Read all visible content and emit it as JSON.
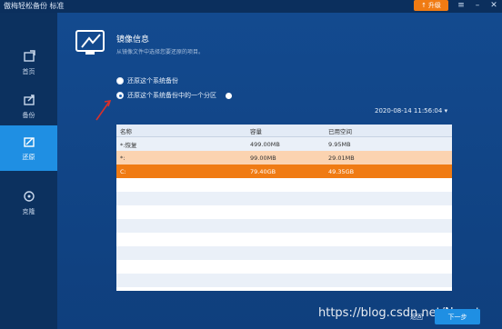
{
  "app": {
    "title": "傲梅轻松备份 标准"
  },
  "titlebar": {
    "upgrade_label": "升级",
    "menu_glyph": "≡",
    "minimize_glyph": "–",
    "close_glyph": "✕"
  },
  "sidebar": {
    "items": [
      {
        "label": "首页",
        "icon": "home-icon"
      },
      {
        "label": "备份",
        "icon": "backup-icon"
      },
      {
        "label": "还原",
        "icon": "restore-icon",
        "active": true
      },
      {
        "label": "克隆",
        "icon": "clone-icon"
      }
    ]
  },
  "main": {
    "title": "镜像信息",
    "subtitle": "从镜像文件中选择您要还原的项目。",
    "options": [
      {
        "label": "还原这个系统备份",
        "selected": false
      },
      {
        "label": "还原这个系统备份中的一个分区",
        "selected": true
      }
    ],
    "timestamp": "2020-08-14 11:56:04",
    "table": {
      "headers": [
        "名称",
        "容量",
        "已用空间"
      ],
      "rows": [
        {
          "name": "*:恢复",
          "capacity": "499.00MB",
          "used": "9.95MB"
        },
        {
          "name": "*:",
          "capacity": "99.00MB",
          "used": "29.01MB"
        },
        {
          "name": "C:",
          "capacity": "79.40GB",
          "used": "49.35GB"
        }
      ]
    }
  },
  "footer": {
    "back_label": "返回",
    "next_label": "下一步",
    "watermark": "https://blog.csdn.net/Noont"
  },
  "colors": {
    "accent": "#1f8fe3",
    "orange": "#f07b13",
    "peach": "#fbd3b0",
    "background": "#0f3f7d"
  }
}
